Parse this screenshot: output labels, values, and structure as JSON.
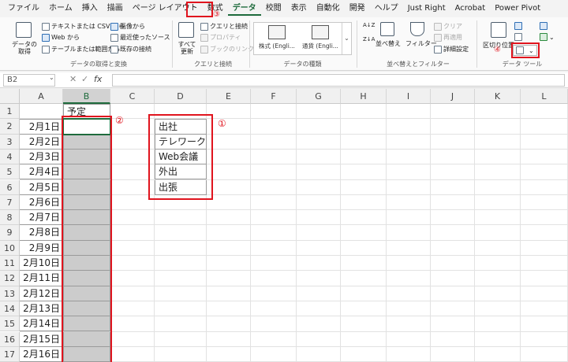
{
  "menu_tabs": [
    "ファイル",
    "ホーム",
    "挿入",
    "描画",
    "ページ レイアウト",
    "数式",
    "データ",
    "校閲",
    "表示",
    "自動化",
    "開発",
    "ヘルプ",
    "Just Right",
    "Acrobat",
    "Power Pivot"
  ],
  "active_tab": "データ",
  "ribbon": {
    "get_data": {
      "label": "データの\n取得",
      "arrow": "⌄"
    },
    "from_text_csv": "テキストまたは CSV から",
    "from_web": "Web から",
    "from_table": "テーブルまたは範囲から",
    "from_picture": "画像から",
    "recent_sources": "最近使ったソース",
    "existing_connections": "既存の接続",
    "group_get_transform": "データの取得と変換",
    "refresh_all": "すべて\n更新",
    "queries_connections": "クエリと接続",
    "properties": "プロパティ",
    "edit_links": "ブックのリンク",
    "group_queries": "クエリと接続",
    "stocks": "株式 (Engli...",
    "currencies": "通貨 (Engli...",
    "group_data_types": "データの種類",
    "sort_asc": "A↓Z",
    "sort_desc": "Z↓A",
    "sort": "並べ替え",
    "filter": "フィルター",
    "clear": "クリア",
    "reapply": "再適用",
    "advanced": "詳細設定",
    "group_sort_filter": "並べ替えとフィルター",
    "text_to_columns": "区切り位置",
    "group_data_tools": "データ ツール",
    "dropdown_arrow": "⌄"
  },
  "formula_bar": {
    "name_box": "B2",
    "cancel": "✕",
    "enter": "✓",
    "fx": "fx",
    "value": ""
  },
  "columns": [
    "A",
    "B",
    "C",
    "D",
    "E",
    "F",
    "G",
    "H",
    "I",
    "J",
    "K",
    "L"
  ],
  "selected_column": "B",
  "rows": [
    "1",
    "2",
    "3",
    "4",
    "5",
    "6",
    "7",
    "8",
    "9",
    "10",
    "11",
    "12",
    "13",
    "14",
    "15",
    "16",
    "17"
  ],
  "sheet": {
    "b1_header": "予定",
    "dates": [
      "2月1日",
      "2月2日",
      "2月3日",
      "2月4日",
      "2月5日",
      "2月6日",
      "2月7日",
      "2月8日",
      "2月9日",
      "2月10日",
      "2月11日",
      "2月12日",
      "2月13日",
      "2月14日",
      "2月15日",
      "2月16日"
    ],
    "list_items": [
      "出社",
      "テレワーク",
      "Web会議",
      "外出",
      "出張"
    ]
  },
  "annotations": {
    "list_marker": "①",
    "input_marker": "②",
    "tab_marker": "③",
    "tool_marker": "④"
  },
  "colors": {
    "accent_green": "#1e6b3c",
    "highlight_red": "#e0141e",
    "shaded_cell": "#cccccc"
  }
}
